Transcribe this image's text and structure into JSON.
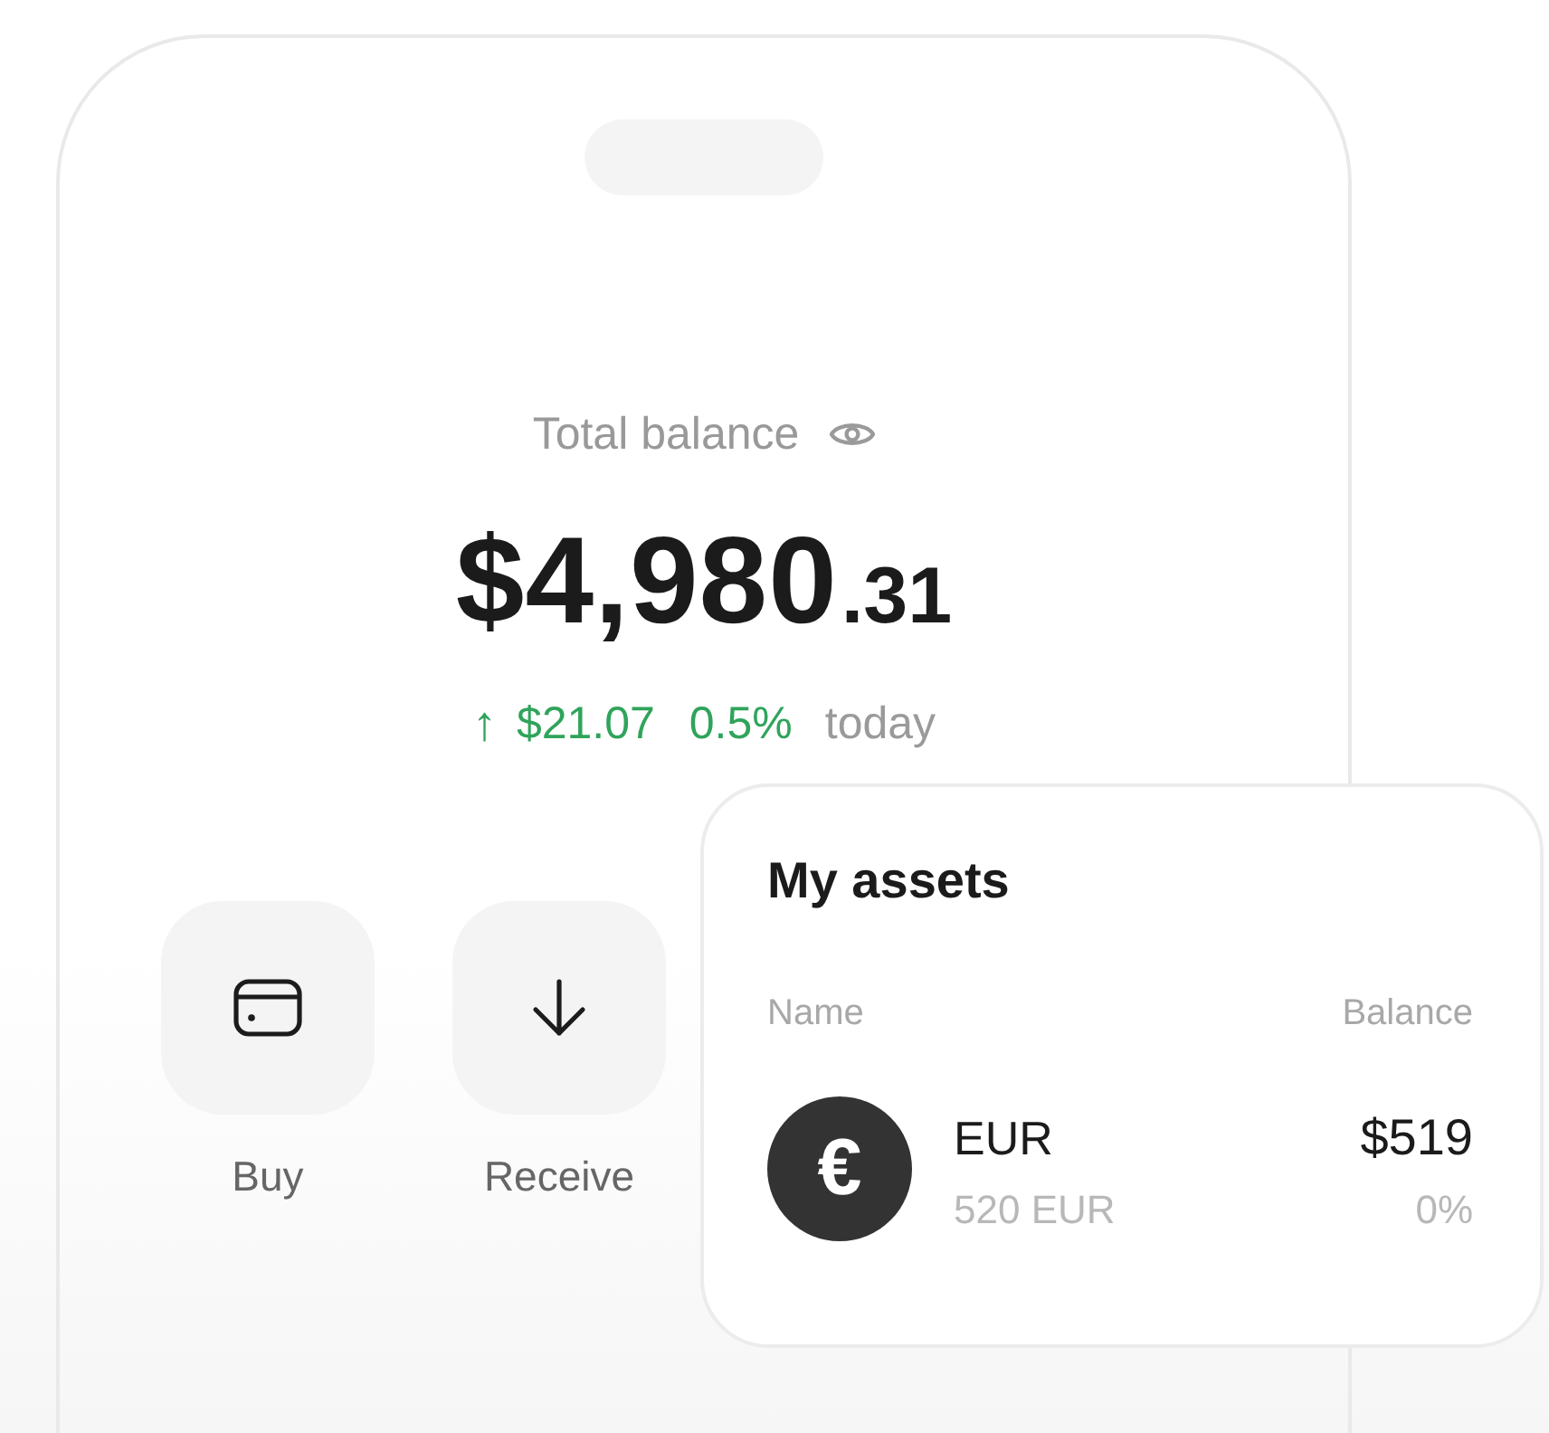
{
  "balance": {
    "label": "Total balance",
    "amount": "$4,980",
    "cents": ".31",
    "change": {
      "positive": true,
      "arrow": "↑",
      "amount": "$21.07",
      "percent": "0.5%",
      "period": "today"
    }
  },
  "actions": [
    {
      "kind": "buy",
      "label": "Buy"
    },
    {
      "kind": "receive",
      "label": "Receive"
    }
  ],
  "assets": {
    "title": "My assets",
    "columns": [
      "Name",
      "Balance"
    ],
    "rows": [
      {
        "symbol": "€",
        "code": "EUR",
        "holding": "520 EUR",
        "value": "$519",
        "change": "0%"
      }
    ]
  }
}
